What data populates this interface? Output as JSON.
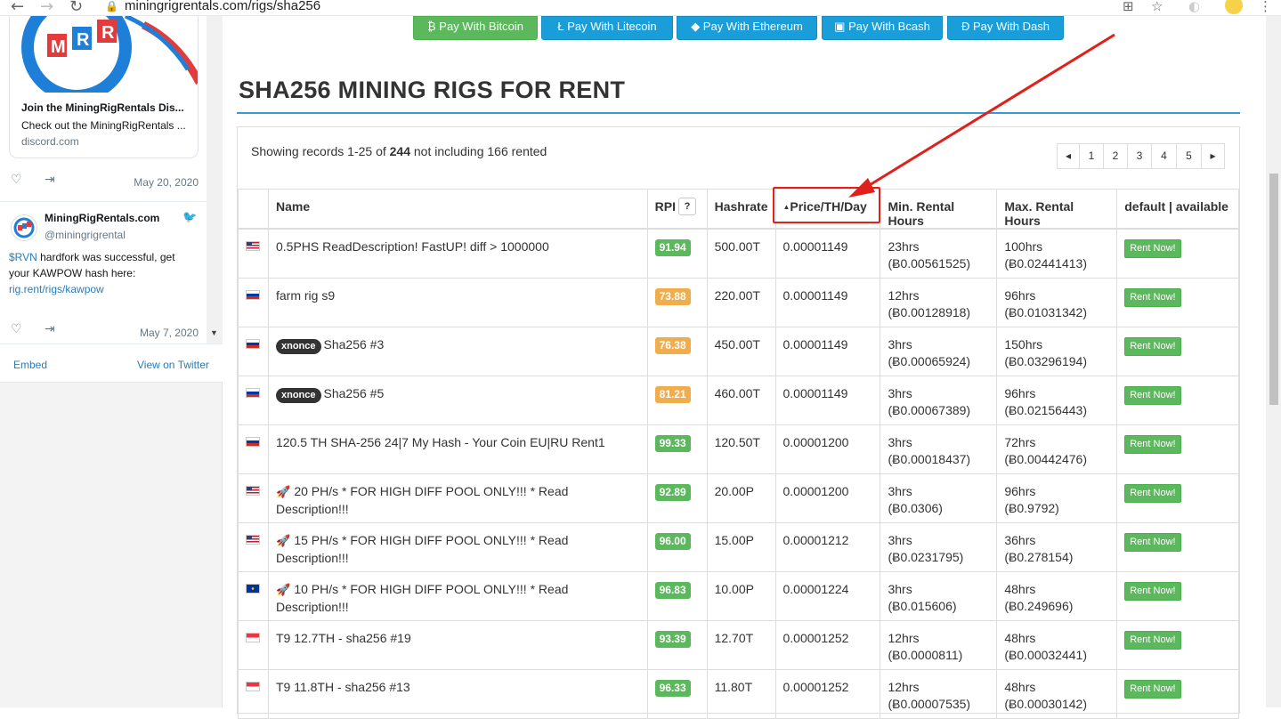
{
  "browser": {
    "url": "miningrigrentals.com/rigs/sha256"
  },
  "sidebar": {
    "card_title": "Join the MiningRigRentals Dis...",
    "card_desc": "Check out the MiningRigRentals ...",
    "card_domain": "discord.com",
    "tweet1_date": "May 20, 2020",
    "account_name": "MiningRigRentals.com",
    "account_handle": "@miningrigrental",
    "tweet_text_prefix": "$RVN",
    "tweet_text_mid": " hardfork was successful, get your KAWPOW hash here: ",
    "tweet_link": "rig.rent/rigs/kawpow",
    "tweet2_date": "May 7, 2020",
    "embed": "Embed",
    "view_on_twitter": "View on Twitter"
  },
  "pay_buttons": [
    {
      "label": "Pay With Bitcoin"
    },
    {
      "label": "Pay With Litecoin"
    },
    {
      "label": "Pay With Ethereum"
    },
    {
      "label": "Pay With Bcash"
    },
    {
      "label": "Pay With Dash"
    }
  ],
  "page_title": "SHA256 MINING RIGS FOR RENT",
  "records": {
    "prefix": "Showing records 1-25 of ",
    "total": "244",
    "suffix": " not including 166 rented"
  },
  "pager": [
    "◂",
    "1",
    "2",
    "3",
    "4",
    "5",
    "▸"
  ],
  "table": {
    "headers": {
      "name": "Name",
      "rpi": "RPI",
      "rpi_help": "?",
      "hashrate": "Hashrate",
      "price": "Price/TH/Day",
      "min": "Min. Rental Hours",
      "max": "Max. Rental Hours",
      "status": "default | available"
    },
    "rows": [
      {
        "flag": "us",
        "tag": "",
        "rocket": false,
        "name": "0.5PHS ReadDescription! FastUP! diff > 1000000",
        "rpi": "91.94",
        "rpi_color": "green",
        "hashrate": "500.00T",
        "price": "0.00001149",
        "min_h": "23hrs",
        "min_b": "(Ƀ0.00561525)",
        "max_h": "100hrs",
        "max_b": "(Ƀ0.02441413)",
        "action": "Rent Now!"
      },
      {
        "flag": "ru",
        "tag": "",
        "rocket": false,
        "name": "farm rig s9",
        "rpi": "73.88",
        "rpi_color": "orange",
        "hashrate": "220.00T",
        "price": "0.00001149",
        "min_h": "12hrs",
        "min_b": "(Ƀ0.00128918)",
        "max_h": "96hrs",
        "max_b": "(Ƀ0.01031342)",
        "action": "Rent Now!"
      },
      {
        "flag": "ru",
        "tag": "xnonce",
        "rocket": false,
        "name": "Sha256 #3",
        "rpi": "76.38",
        "rpi_color": "orange",
        "hashrate": "450.00T",
        "price": "0.00001149",
        "min_h": "3hrs",
        "min_b": "(Ƀ0.00065924)",
        "max_h": "150hrs",
        "max_b": "(Ƀ0.03296194)",
        "action": "Rent Now!"
      },
      {
        "flag": "ru",
        "tag": "xnonce",
        "rocket": false,
        "name": "Sha256 #5",
        "rpi": "81.21",
        "rpi_color": "orange",
        "hashrate": "460.00T",
        "price": "0.00001149",
        "min_h": "3hrs",
        "min_b": "(Ƀ0.00067389)",
        "max_h": "96hrs",
        "max_b": "(Ƀ0.02156443)",
        "action": "Rent Now!"
      },
      {
        "flag": "ru",
        "tag": "",
        "rocket": false,
        "name": "120.5 TH SHA-256 24|7 My Hash - Your Coin EU|RU Rent1",
        "rpi": "99.33",
        "rpi_color": "green",
        "hashrate": "120.50T",
        "price": "0.00001200",
        "min_h": "3hrs",
        "min_b": "(Ƀ0.00018437)",
        "max_h": "72hrs",
        "max_b": "(Ƀ0.00442476)",
        "action": "Rent Now!"
      },
      {
        "flag": "us",
        "tag": "",
        "rocket": true,
        "name": "20 PH/s * FOR HIGH DIFF POOL ONLY!!! * Read Description!!!",
        "rpi": "92.89",
        "rpi_color": "green",
        "hashrate": "20.00P",
        "price": "0.00001200",
        "min_h": "3hrs",
        "min_b": "(Ƀ0.0306)",
        "max_h": "96hrs",
        "max_b": "(Ƀ0.9792)",
        "action": "Rent Now!"
      },
      {
        "flag": "us",
        "tag": "",
        "rocket": true,
        "name": "15 PH/s * FOR HIGH DIFF POOL ONLY!!! * Read Description!!!",
        "rpi": "96.00",
        "rpi_color": "green",
        "hashrate": "15.00P",
        "price": "0.00001212",
        "min_h": "3hrs",
        "min_b": "(Ƀ0.0231795)",
        "max_h": "36hrs",
        "max_b": "(Ƀ0.278154)",
        "action": "Rent Now!"
      },
      {
        "flag": "eu",
        "tag": "",
        "rocket": true,
        "name": "10 PH/s * FOR HIGH DIFF POOL ONLY!!! * Read Description!!!",
        "rpi": "96.83",
        "rpi_color": "green",
        "hashrate": "10.00P",
        "price": "0.00001224",
        "min_h": "3hrs",
        "min_b": "(Ƀ0.015606)",
        "max_h": "48hrs",
        "max_b": "(Ƀ0.249696)",
        "action": "Rent Now!"
      },
      {
        "flag": "sg",
        "tag": "",
        "rocket": false,
        "name": "T9 12.7TH - sha256 #19",
        "rpi": "93.39",
        "rpi_color": "green",
        "hashrate": "12.70T",
        "price": "0.00001252",
        "min_h": "12hrs",
        "min_b": "(Ƀ0.0000811)",
        "max_h": "48hrs",
        "max_b": "(Ƀ0.00032441)",
        "action": "Rent Now!"
      },
      {
        "flag": "sg",
        "tag": "",
        "rocket": false,
        "name": "T9 11.8TH - sha256 #13",
        "rpi": "96.33",
        "rpi_color": "green",
        "hashrate": "11.80T",
        "price": "0.00001252",
        "min_h": "12hrs",
        "min_b": "(Ƀ0.00007535)",
        "max_h": "48hrs",
        "max_b": "(Ƀ0.00030142)",
        "action": "Rent Now!"
      }
    ]
  },
  "colors": {
    "accent_blue": "#3a9ad9",
    "green": "#5cb85c",
    "orange": "#f0ad4e",
    "annotation_red": "#e0201a"
  }
}
